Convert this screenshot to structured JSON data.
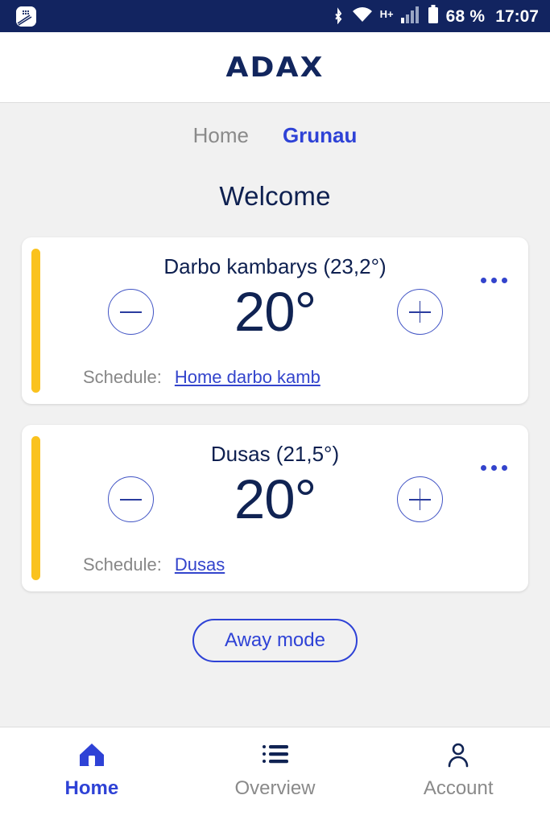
{
  "status_bar": {
    "notification_icon": "app-notification-icon",
    "bluetooth_icon": "bluetooth-icon",
    "wifi_icon": "wifi-icon",
    "network_type": "H+",
    "signal_icon": "cellular-signal-icon",
    "battery_icon": "battery-icon",
    "battery_level": "68 %",
    "time": "17:07",
    "background_color": "#122460"
  },
  "header": {
    "logo_text": "ADAX",
    "logo_color": "#12265e"
  },
  "tabs": [
    {
      "label": "Home",
      "active": false
    },
    {
      "label": "Grunau",
      "active": true
    }
  ],
  "page_title": "Welcome",
  "cards": [
    {
      "title": "Darbo kambarys (23,2°)",
      "accent_color": "#fac21e",
      "decrease_label": "−",
      "increase_label": "+",
      "setpoint": "20°",
      "schedule_label": "Schedule:",
      "schedule_value": "Home darbo kamb",
      "menu_label": "•••"
    },
    {
      "title": "Dusas (21,5°)",
      "accent_color": "#fac21e",
      "decrease_label": "−",
      "increase_label": "+",
      "setpoint": "20°",
      "schedule_label": "Schedule:",
      "schedule_value": "Dusas",
      "menu_label": "•••"
    }
  ],
  "away_button": {
    "label": "Away mode",
    "color": "#2e42d6"
  },
  "bottom_nav": [
    {
      "label": "Home",
      "icon": "home-icon",
      "active": true
    },
    {
      "label": "Overview",
      "icon": "list-icon",
      "active": false
    },
    {
      "label": "Account",
      "icon": "person-icon",
      "active": false
    }
  ],
  "colors": {
    "navy": "#102353",
    "blue": "#2e42d6",
    "link": "#3344cc",
    "gray_text": "#8a8a8a",
    "page_bg": "#f1f1f1"
  }
}
